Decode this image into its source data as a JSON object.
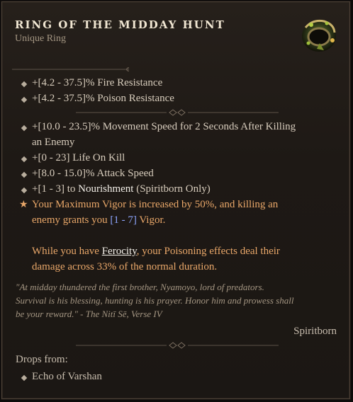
{
  "item": {
    "name": "RING OF THE MIDDAY HUNT",
    "type": "Unique Ring"
  },
  "affixes": [
    "+[4.2 - 37.5]% Fire Resistance",
    "+[4.2 - 37.5]% Poison Resistance"
  ],
  "stats": {
    "s0_line1": "+[10.0 - 23.5]% Movement Speed for 2 Seconds After Killing",
    "s0_line2": "an Enemy",
    "s1": "+[0 - 23] Life On Kill",
    "s2": "+[8.0 - 15.0]% Attack Speed",
    "s3_prefix": "+[1 - 3] to ",
    "s3_bold": "Nourishment",
    "s3_suffix": " (Spiritborn Only)"
  },
  "unique_power": {
    "line1": "Your Maximum Vigor is increased by 50%, and killing an",
    "line2_prefix": "enemy grants you ",
    "line2_range": "[1 - 7]",
    "line2_suffix": " Vigor.",
    "line3_prefix": "While you have ",
    "line3_link": "Ferocity",
    "line3_suffix": ", your Poisoning effects deal their",
    "line4": "damage across 33% of the normal duration."
  },
  "flavor": {
    "line1": "\"At midday thundered the first brother, Nyamoyo, lord of predators.",
    "line2": "Survival is his blessing, hunting is his prayer. Honor him and prowess shall",
    "line3": "be your reward.\" - The Nitī Sē, Verse IV"
  },
  "class_requirement": "Spiritborn",
  "drops": {
    "label": "Drops from:",
    "sources": [
      "Echo of Varshan"
    ]
  },
  "colors": {
    "unique_orange": "#e9a769",
    "range_blue": "#8ea6ff",
    "body_text": "#d7ccbc"
  },
  "icons": {
    "item": "ring-icon",
    "bullet": "diamond-bullet-icon",
    "unique": "star-icon"
  }
}
